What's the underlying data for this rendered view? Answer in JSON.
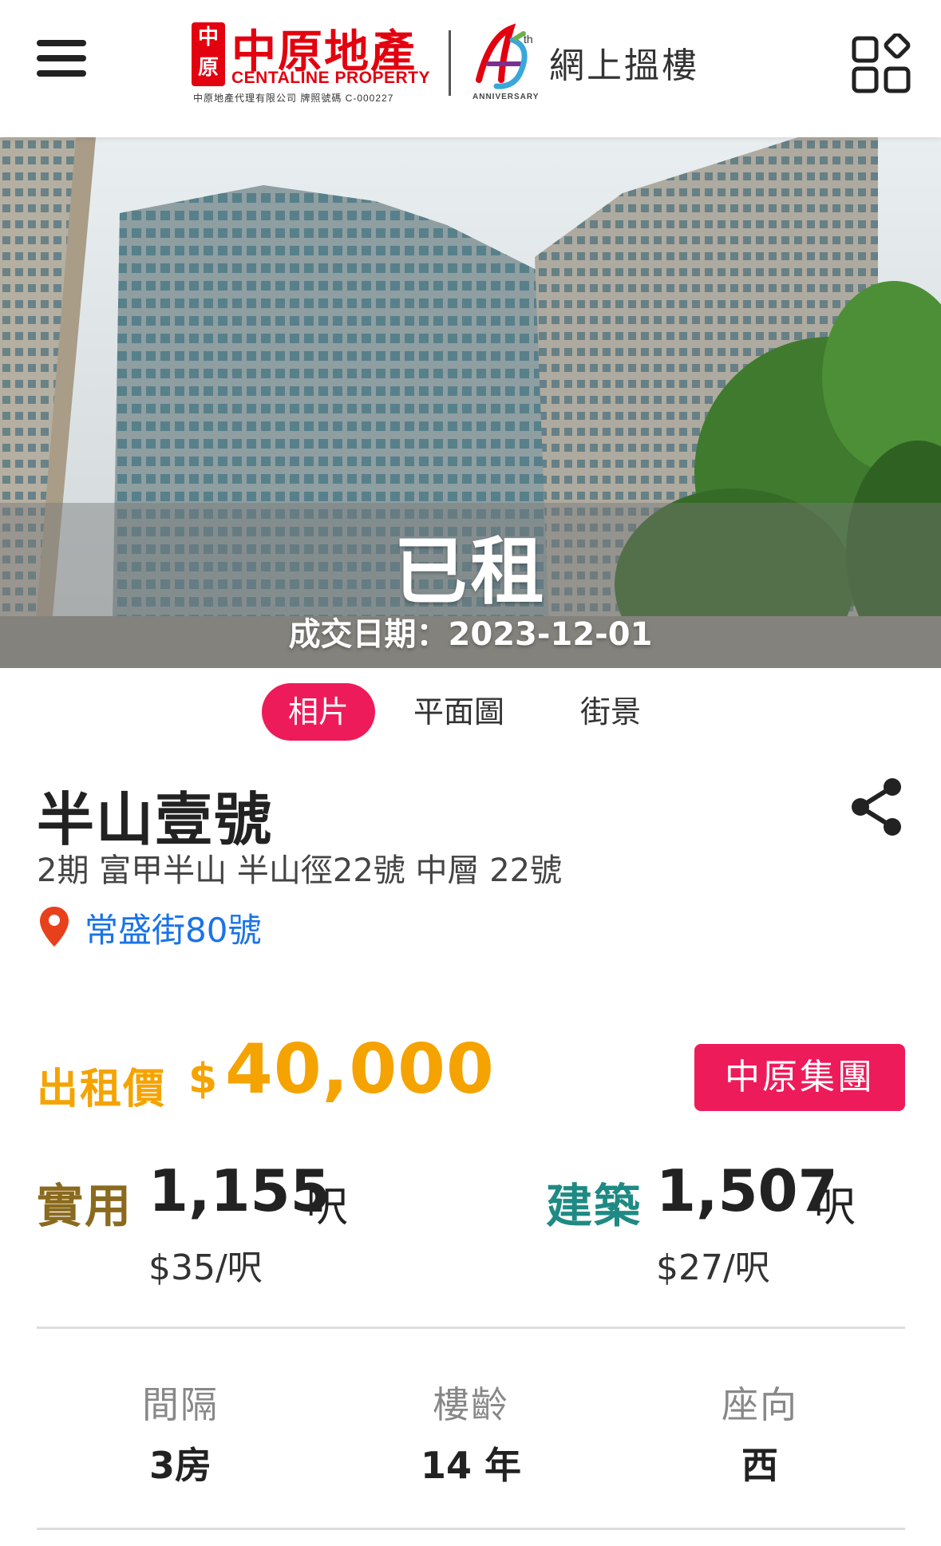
{
  "header": {
    "brand_seal": "中原",
    "brand_name_cn": "中原地產",
    "brand_name_en": "CENTALINE PROPERTY",
    "license_text": "中原地產代理有限公司 牌照號碼 C-000227",
    "anniversary_number": "45",
    "anniversary_suffix": "th",
    "anniversary_text": "ANNIVERSARY",
    "section_title": "網上搵樓",
    "icons": {
      "menu": "hamburger-menu-icon",
      "apps": "app-grid-icon"
    }
  },
  "hero": {
    "status": "已租",
    "deal_date": "成交日期：2023-12-01"
  },
  "tabs": [
    {
      "label": "相片",
      "active": true
    },
    {
      "label": "平面圖",
      "active": false
    },
    {
      "label": "街景",
      "active": false
    }
  ],
  "listing": {
    "title": "半山壹號",
    "subtitle": "2期 富甲半山 半山徑22號 中層 22號",
    "address": "常盛街80號"
  },
  "price": {
    "label": "出租價",
    "currency": "$",
    "value": "40,000",
    "agency": "中原集團"
  },
  "area": {
    "saleable": {
      "label": "實用",
      "value": "1,155",
      "unit": "呎",
      "per_sqft": "$35/呎"
    },
    "gross": {
      "label": "建築",
      "value": "1,507",
      "unit": "呎",
      "per_sqft": "$27/呎"
    }
  },
  "specs": [
    {
      "label": "間隔",
      "value": "3房"
    },
    {
      "label": "樓齡",
      "value": "14 年"
    },
    {
      "label": "座向",
      "value": "西"
    }
  ],
  "colors": {
    "brand_red": "#e3000f",
    "accent_pink": "#ee1b5a",
    "price_orange": "#f5a300",
    "saleable_brown": "#8a6a1e",
    "gross_teal": "#1f8a84",
    "link_blue": "#1a73e8"
  }
}
